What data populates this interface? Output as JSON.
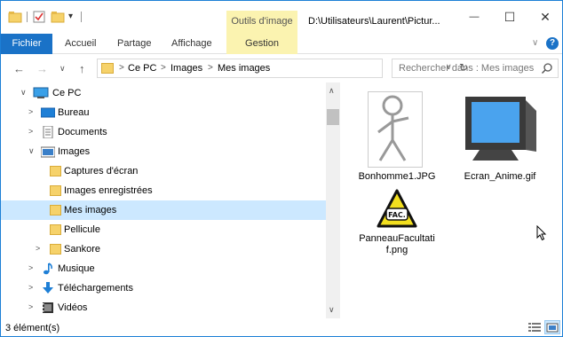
{
  "titlebar": {
    "context_tab": "Outils d'image",
    "window_title": "D:\\Utilisateurs\\Laurent\\Pictur...",
    "minimize": "—",
    "maximize": "☐",
    "close": "✕"
  },
  "ribbon": {
    "file": "Fichier",
    "tabs": [
      "Accueil",
      "Partage",
      "Affichage"
    ],
    "context_sub": "Gestion",
    "chevron": "∨",
    "help": "?"
  },
  "address": {
    "back": "←",
    "forward": "→",
    "recent": "∨",
    "up": "↑",
    "sep": ">",
    "crumbs": [
      "Ce PC",
      "Images",
      "Mes images"
    ],
    "dropdown": "∨",
    "refresh": "↻"
  },
  "search": {
    "placeholder": "Rechercher dans : Mes images"
  },
  "nav": {
    "items": [
      {
        "label": "Ce PC",
        "icon": "computer-icon",
        "arrow": "∨"
      },
      {
        "label": "Bureau",
        "icon": "desktop-icon",
        "arrow": ">"
      },
      {
        "label": "Documents",
        "icon": "documents-icon",
        "arrow": ">"
      },
      {
        "label": "Images",
        "icon": "pictures-icon",
        "arrow": "∨"
      },
      {
        "label": "Captures d'écran",
        "icon": "folder-icon",
        "arrow": ""
      },
      {
        "label": "Images enregistrées",
        "icon": "folder-icon",
        "arrow": ""
      },
      {
        "label": "Mes images",
        "icon": "folder-icon",
        "arrow": ""
      },
      {
        "label": "Pellicule",
        "icon": "folder-icon",
        "arrow": ""
      },
      {
        "label": "Sankore",
        "icon": "folder-icon",
        "arrow": ">"
      },
      {
        "label": "Musique",
        "icon": "music-icon",
        "arrow": ">"
      },
      {
        "label": "Téléchargements",
        "icon": "downloads-icon",
        "arrow": ">"
      },
      {
        "label": "Vidéos",
        "icon": "videos-icon",
        "arrow": ">"
      }
    ],
    "selected": "Mes images"
  },
  "scrollbar": {
    "up": "∧",
    "down": "∨"
  },
  "files": [
    {
      "name": "Bonhomme1.JPG",
      "icon": "stick-figure-thumbnail"
    },
    {
      "name": "Ecran_Anime.gif",
      "icon": "crt-monitor-thumbnail"
    },
    {
      "name": "PanneauFacultatif.png",
      "line1": "PanneauFacultati",
      "line2": "f.png",
      "icon": "fac-sign-thumbnail",
      "sign_text": "FAC."
    }
  ],
  "status": {
    "count": "3 élément(s)"
  },
  "colors": {
    "accent": "#1a72c7",
    "context": "#fbf3b0",
    "selection": "#cce8ff",
    "folder": "#f6d26a"
  }
}
